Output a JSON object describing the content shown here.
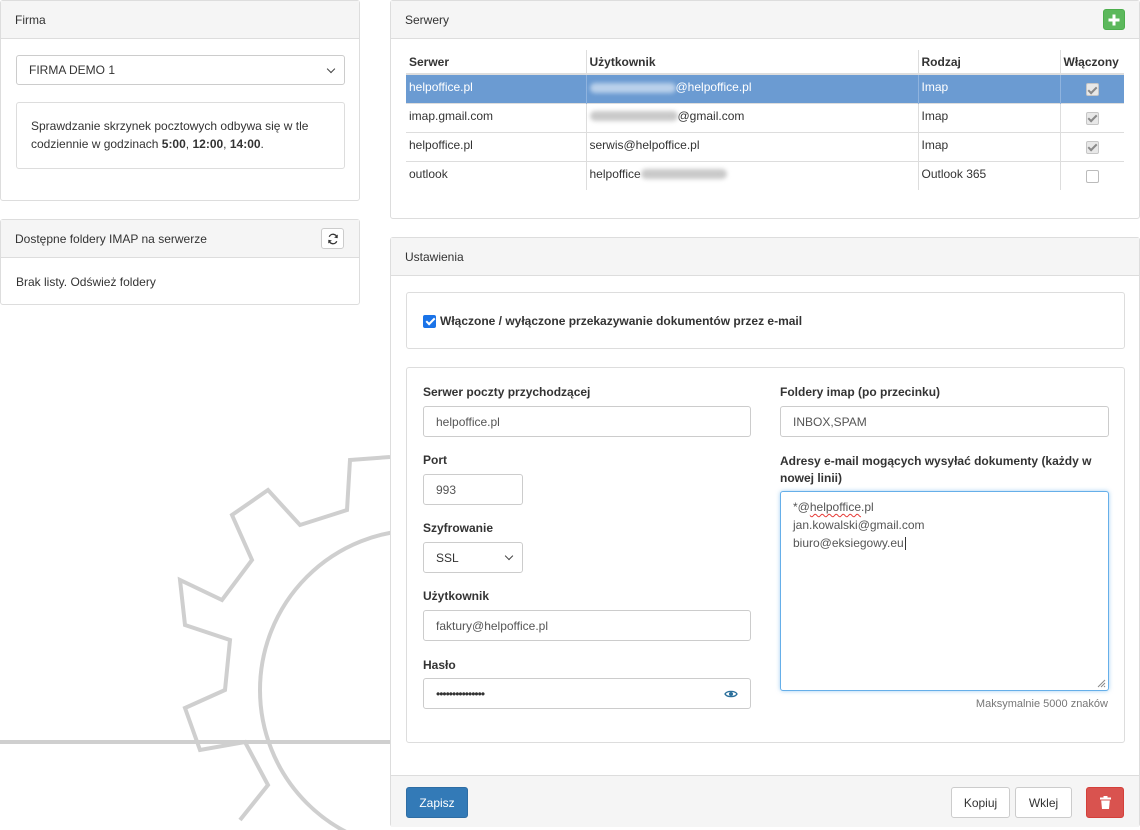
{
  "firma": {
    "heading": "Firma",
    "selected_company": "FIRMA DEMO 1",
    "info_text_before": "Sprawdzanie skrzynek pocztowych odbywa się w tle codziennie w godzinach ",
    "time1": "5:00",
    "time_sep1": ", ",
    "time2": "12:00",
    "time_sep2": ", ",
    "time3": "14:00",
    "info_text_after": "."
  },
  "folders": {
    "heading": "Dostępne foldery IMAP na serwerze",
    "empty_text": "Brak listy. Odśwież foldery"
  },
  "servers": {
    "heading": "Serwery",
    "columns": [
      "Serwer",
      "Użytkownik",
      "Rodzaj",
      "Włączony"
    ],
    "rows": [
      {
        "server": "helpoffice.pl",
        "user_visible": "@helpoffice.pl",
        "type": "Imap",
        "enabled": true,
        "selected": true
      },
      {
        "server": "imap.gmail.com",
        "user_visible": "@gmail.com",
        "type": "Imap",
        "enabled": true,
        "selected": false
      },
      {
        "server": "helpoffice.pl",
        "user_visible": "serwis@helpoffice.pl",
        "type": "Imap",
        "enabled": true,
        "selected": false
      },
      {
        "server": "outlook",
        "user_visible": "helpoffice",
        "type": "Outlook 365",
        "enabled": false,
        "selected": false
      }
    ]
  },
  "settings": {
    "heading": "Ustawienia",
    "forwarding_label": "Włączone / wyłączone przekazywanie dokumentów przez e-mail",
    "forwarding_enabled": true,
    "incoming_server_label": "Serwer poczty przychodzącej",
    "incoming_server_value": "helpoffice.pl",
    "port_label": "Port",
    "port_value": "993",
    "encryption_label": "Szyfrowanie",
    "encryption_value": "SSL",
    "user_label": "Użytkownik",
    "user_value": "faktury@helpoffice.pl",
    "password_label": "Hasło",
    "password_value": "•••••••••••••••",
    "folders_label": "Foldery imap (po przecinku)",
    "folders_value": "INBOX,SPAM",
    "addresses_label": "Adresy e-mail mogących wysyłać dokumenty (każdy w nowej linii)",
    "addresses": [
      "*@helpoffice.pl",
      "jan.kowalski@gmail.com",
      "biuro@eksiegowy.eu"
    ],
    "max_chars_hint": "Maksymalnie 5000 znaków"
  },
  "footer": {
    "save_label": "Zapisz",
    "copy_label": "Kopiuj",
    "paste_label": "Wklej"
  },
  "colors": {
    "primary": "#337ab7",
    "danger": "#d9534f",
    "success": "#5cb85c",
    "selected_row": "#6b9bd2"
  }
}
